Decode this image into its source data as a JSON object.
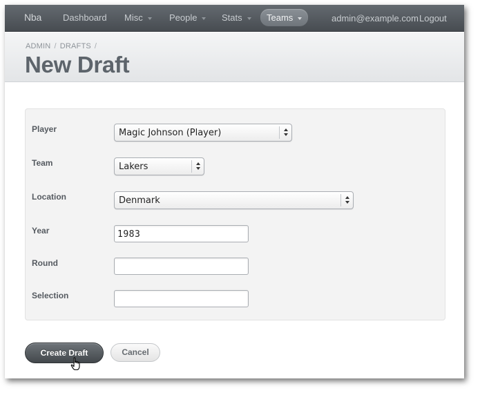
{
  "navbar": {
    "brand": "Nba",
    "items": [
      {
        "label": "Dashboard",
        "dropdown": false,
        "active": false
      },
      {
        "label": "Misc",
        "dropdown": true,
        "active": false
      },
      {
        "label": "People",
        "dropdown": true,
        "active": false
      },
      {
        "label": "Stats",
        "dropdown": true,
        "active": false
      },
      {
        "label": "Teams",
        "dropdown": true,
        "active": true
      }
    ],
    "user_email": "admin@example.com",
    "logout_label": "Logout"
  },
  "breadcrumb": [
    "ADMIN",
    "DRAFTS"
  ],
  "page_title": "New Draft",
  "form": {
    "player": {
      "label": "Player",
      "value": "Magic Johnson (Player)"
    },
    "team": {
      "label": "Team",
      "value": "Lakers"
    },
    "location": {
      "label": "Location",
      "value": "Denmark"
    },
    "year": {
      "label": "Year",
      "value": "1983"
    },
    "round": {
      "label": "Round",
      "value": ""
    },
    "selection": {
      "label": "Selection",
      "value": ""
    }
  },
  "actions": {
    "submit_label": "Create Draft",
    "cancel_label": "Cancel"
  },
  "icons": {
    "dropdown": "caret-down-icon",
    "select_spinner": "updown-arrows-icon",
    "cursor": "hand-pointer-icon"
  }
}
